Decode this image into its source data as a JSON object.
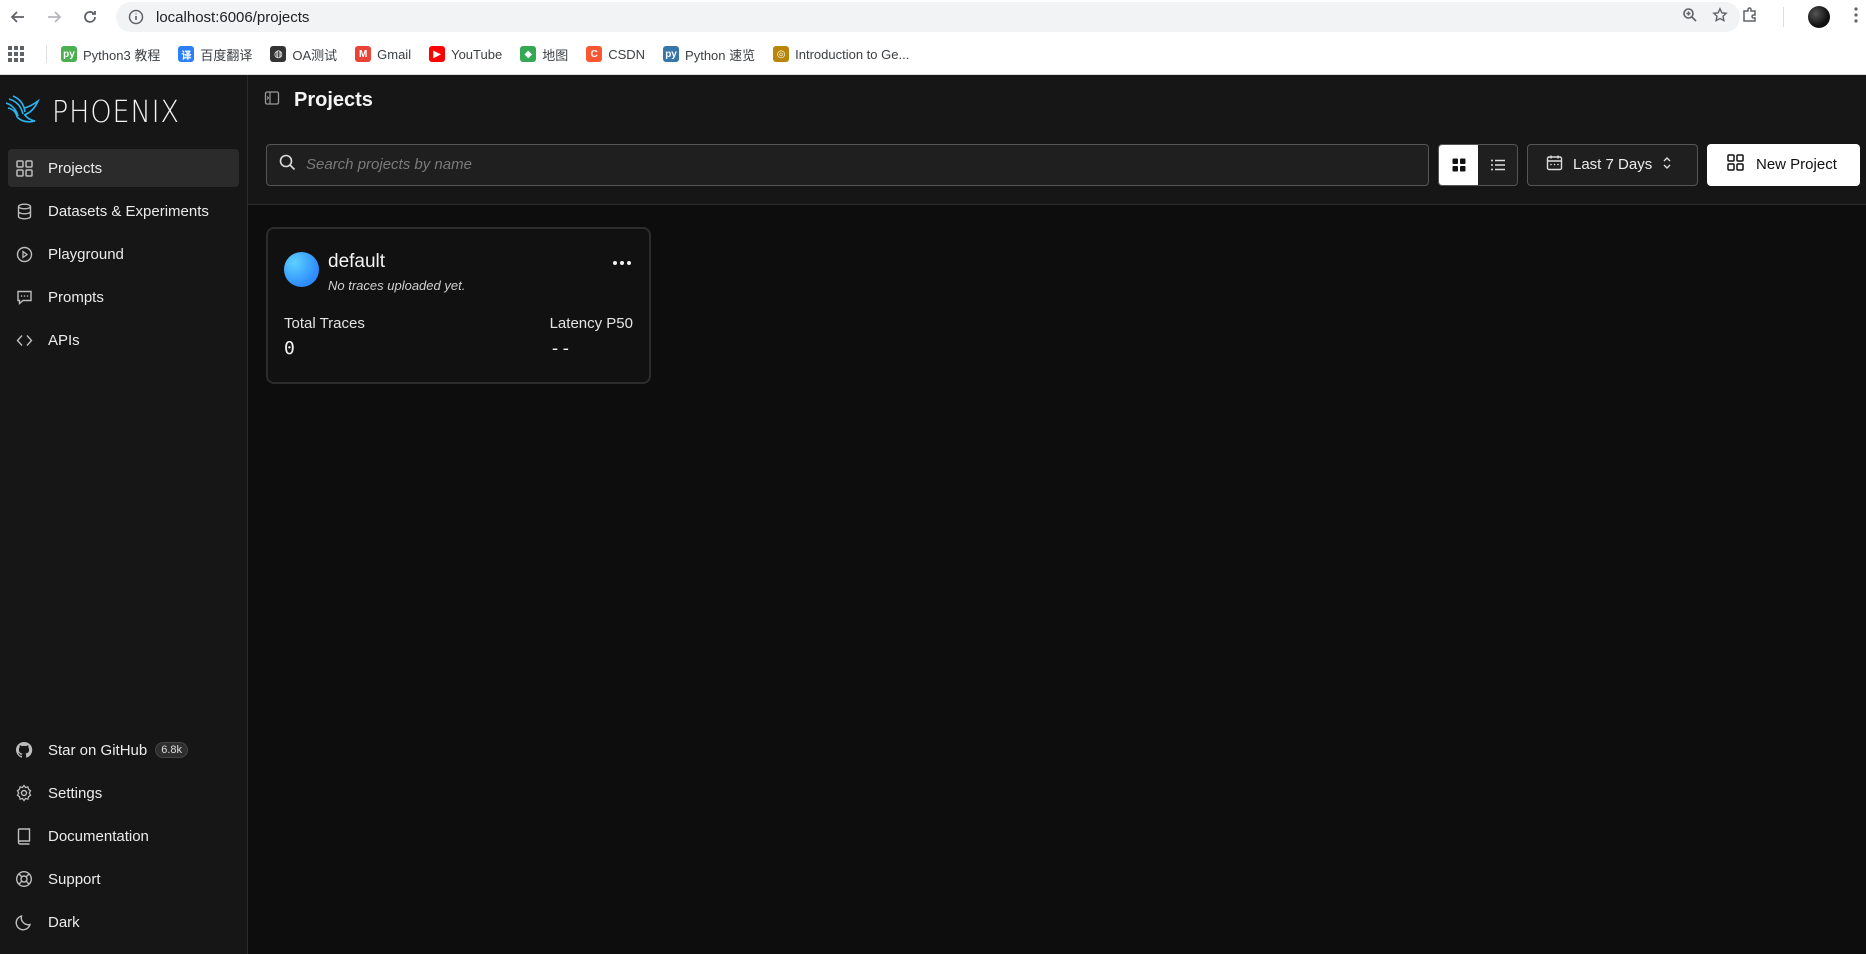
{
  "browser": {
    "url": "localhost:6006/projects",
    "bookmarks": [
      {
        "label": "Python3 教程",
        "color": "#4caf50",
        "glyph": "py"
      },
      {
        "label": "百度翻译",
        "color": "#2d7ff9",
        "glyph": "译"
      },
      {
        "label": "OA测试",
        "color": "#333333",
        "glyph": "◍"
      },
      {
        "label": "Gmail",
        "color": "#ea4335",
        "glyph": "M"
      },
      {
        "label": "YouTube",
        "color": "#ff0000",
        "glyph": "▶"
      },
      {
        "label": "地图",
        "color": "#34a853",
        "glyph": "◆"
      },
      {
        "label": "CSDN",
        "color": "#fc5531",
        "glyph": "C"
      },
      {
        "label": "Python 速览",
        "color": "#3776ab",
        "glyph": "py"
      },
      {
        "label": "Introduction to Ge...",
        "color": "#b8860b",
        "glyph": "◎"
      }
    ]
  },
  "brand": {
    "name": "PHOENIX"
  },
  "sidebar": {
    "items": [
      {
        "label": "Projects",
        "icon": "grid-icon",
        "active": true
      },
      {
        "label": "Datasets & Experiments",
        "icon": "database-icon"
      },
      {
        "label": "Playground",
        "icon": "play-icon"
      },
      {
        "label": "Prompts",
        "icon": "message-icon"
      },
      {
        "label": "APIs",
        "icon": "code-icon"
      }
    ],
    "bottom": {
      "github_label": "Star on GitHub",
      "github_count": "6.8k",
      "settings": "Settings",
      "documentation": "Documentation",
      "support": "Support",
      "theme": "Dark"
    }
  },
  "header": {
    "title": "Projects"
  },
  "toolbar": {
    "search_placeholder": "Search projects by name",
    "time_range": "Last 7 Days",
    "new_project": "New Project"
  },
  "projects": [
    {
      "name": "default",
      "subtitle": "No traces uploaded yet.",
      "total_traces_label": "Total Traces",
      "total_traces": "0",
      "latency_label": "Latency P50",
      "latency": "--"
    }
  ],
  "colors": {
    "accent": "#2d8cff",
    "background": "#0d0d0d",
    "panel": "#161616"
  }
}
